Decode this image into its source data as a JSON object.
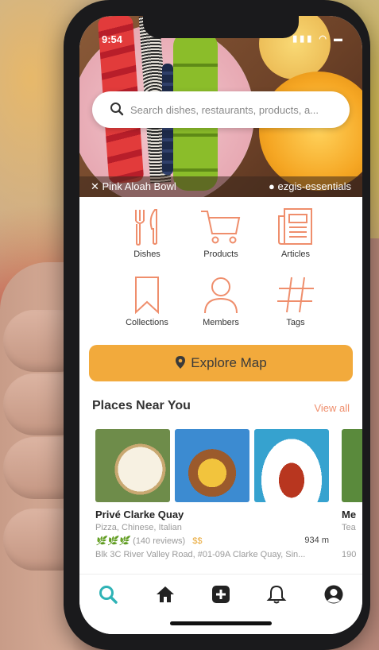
{
  "status_bar": {
    "time": "9:54",
    "icons": "▮▮▮ ◠ ▬"
  },
  "search": {
    "placeholder": "Search dishes, restaurants, products, a..."
  },
  "hero": {
    "dish_label": "Pink Aloah Bowl",
    "user_label": "ezgis-essentials"
  },
  "categories": [
    {
      "label": "Dishes",
      "icon": "fork-knife-icon"
    },
    {
      "label": "Products",
      "icon": "cart-icon"
    },
    {
      "label": "Articles",
      "icon": "newspaper-icon"
    },
    {
      "label": "Collections",
      "icon": "bookmark-icon"
    },
    {
      "label": "Members",
      "icon": "person-icon"
    },
    {
      "label": "Tags",
      "icon": "hashtag-icon"
    }
  ],
  "explore_button": {
    "label": "Explore Map"
  },
  "places": {
    "title": "Places Near You",
    "view_all": "View all",
    "items": [
      {
        "name": "Privé Clarke Quay",
        "cuisine": "Pizza, Chinese, Italian",
        "leaves": "🌿🌿🌿",
        "reviews": "(140 reviews)",
        "price": "$$",
        "distance": "934 m",
        "address": "Blk 3C River Valley Road, #01-09A Clarke Quay, Sin..."
      },
      {
        "name": "Me",
        "cuisine": "Tea",
        "address": "190"
      }
    ]
  },
  "nav": [
    {
      "name": "search",
      "active": true
    },
    {
      "name": "home"
    },
    {
      "name": "add"
    },
    {
      "name": "notifications"
    },
    {
      "name": "profile"
    }
  ],
  "colors": {
    "accent": "#ef8e6c",
    "primary": "#f2aa3c",
    "nav_active": "#2fb3b6",
    "icon_stroke": "#ef8e6c"
  }
}
